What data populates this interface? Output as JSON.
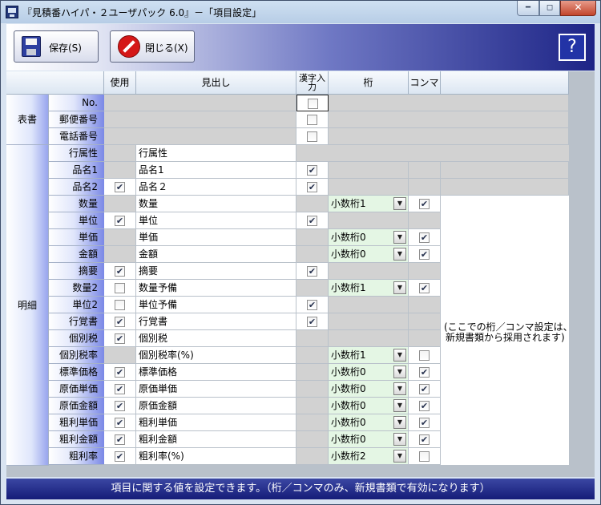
{
  "window": {
    "title": "『見積番ハイパ・２ユーザパック 6.0』－「項目設定」"
  },
  "toolbar": {
    "save_label": "保存(S)",
    "close_label": "閉じる(X)",
    "help_label": "?"
  },
  "headers": {
    "use": "使用",
    "heading": "見出し",
    "kanji": "漢字入力",
    "digits": "桁",
    "comma": "コンマ"
  },
  "sections": {
    "hyosho": "表書",
    "meisai": "明細"
  },
  "hyosho_rows": [
    {
      "label": "No.",
      "kanji_checked": false
    },
    {
      "label": "郵便番号",
      "kanji_checked": false
    },
    {
      "label": "電話番号",
      "kanji_checked": false
    }
  ],
  "meisai_rows": [
    {
      "label": "行属性",
      "use": null,
      "heading": "行属性",
      "kanji": null,
      "digits": null,
      "comma": null
    },
    {
      "label": "品名1",
      "use": null,
      "heading": "品名1",
      "kanji": true,
      "digits": null,
      "comma": null
    },
    {
      "label": "品名2",
      "use": true,
      "heading": "品名２",
      "kanji": true,
      "digits": null,
      "comma": null
    },
    {
      "label": "数量",
      "use": null,
      "heading": "数量",
      "kanji": null,
      "digits": "小数桁1",
      "comma": true
    },
    {
      "label": "単位",
      "use": true,
      "heading": "単位",
      "kanji": true,
      "digits": null,
      "comma": null
    },
    {
      "label": "単価",
      "use": null,
      "heading": "単価",
      "kanji": null,
      "digits": "小数桁0",
      "comma": true
    },
    {
      "label": "金額",
      "use": null,
      "heading": "金額",
      "kanji": null,
      "digits": "小数桁0",
      "comma": true
    },
    {
      "label": "摘要",
      "use": true,
      "heading": "摘要",
      "kanji": true,
      "digits": null,
      "comma": null
    },
    {
      "label": "数量2",
      "use": false,
      "heading": "数量予備",
      "kanji": null,
      "digits": "小数桁1",
      "comma": true
    },
    {
      "label": "単位2",
      "use": false,
      "heading": "単位予備",
      "kanji": true,
      "digits": null,
      "comma": null
    },
    {
      "label": "行覚書",
      "use": true,
      "heading": "行覚書",
      "kanji": true,
      "digits": null,
      "comma": null
    },
    {
      "label": "個別税",
      "use": true,
      "heading": "個別税",
      "kanji": null,
      "digits": null,
      "comma": null
    },
    {
      "label": "個別税率",
      "use": null,
      "heading": "個別税率(%)",
      "kanji": null,
      "digits": "小数桁1",
      "comma": false
    },
    {
      "label": "標準価格",
      "use": true,
      "heading": "標準価格",
      "kanji": null,
      "digits": "小数桁0",
      "comma": true
    },
    {
      "label": "原価単価",
      "use": true,
      "heading": "原価単価",
      "kanji": null,
      "digits": "小数桁0",
      "comma": true
    },
    {
      "label": "原価金額",
      "use": true,
      "heading": "原価金額",
      "kanji": null,
      "digits": "小数桁0",
      "comma": true
    },
    {
      "label": "粗利単価",
      "use": true,
      "heading": "粗利単価",
      "kanji": null,
      "digits": "小数桁0",
      "comma": true
    },
    {
      "label": "粗利金額",
      "use": true,
      "heading": "粗利金額",
      "kanji": null,
      "digits": "小数桁0",
      "comma": true
    },
    {
      "label": "粗利率",
      "use": true,
      "heading": "粗利率(%)",
      "kanji": null,
      "digits": "小数桁2",
      "comma": false
    }
  ],
  "note": {
    "line1": "(ここでの桁／コンマ設定は、",
    "line2": "新規書類から採用されます)"
  },
  "status": {
    "message": "項目に関する値を設定できます。（桁／コンマのみ、新規書類で有効になります）"
  },
  "icons": {
    "app": "app-icon",
    "save": "floppy-disk-icon",
    "close": "no-entry-icon",
    "help": "help-icon",
    "dropdown": "dropdown-arrow-icon"
  }
}
